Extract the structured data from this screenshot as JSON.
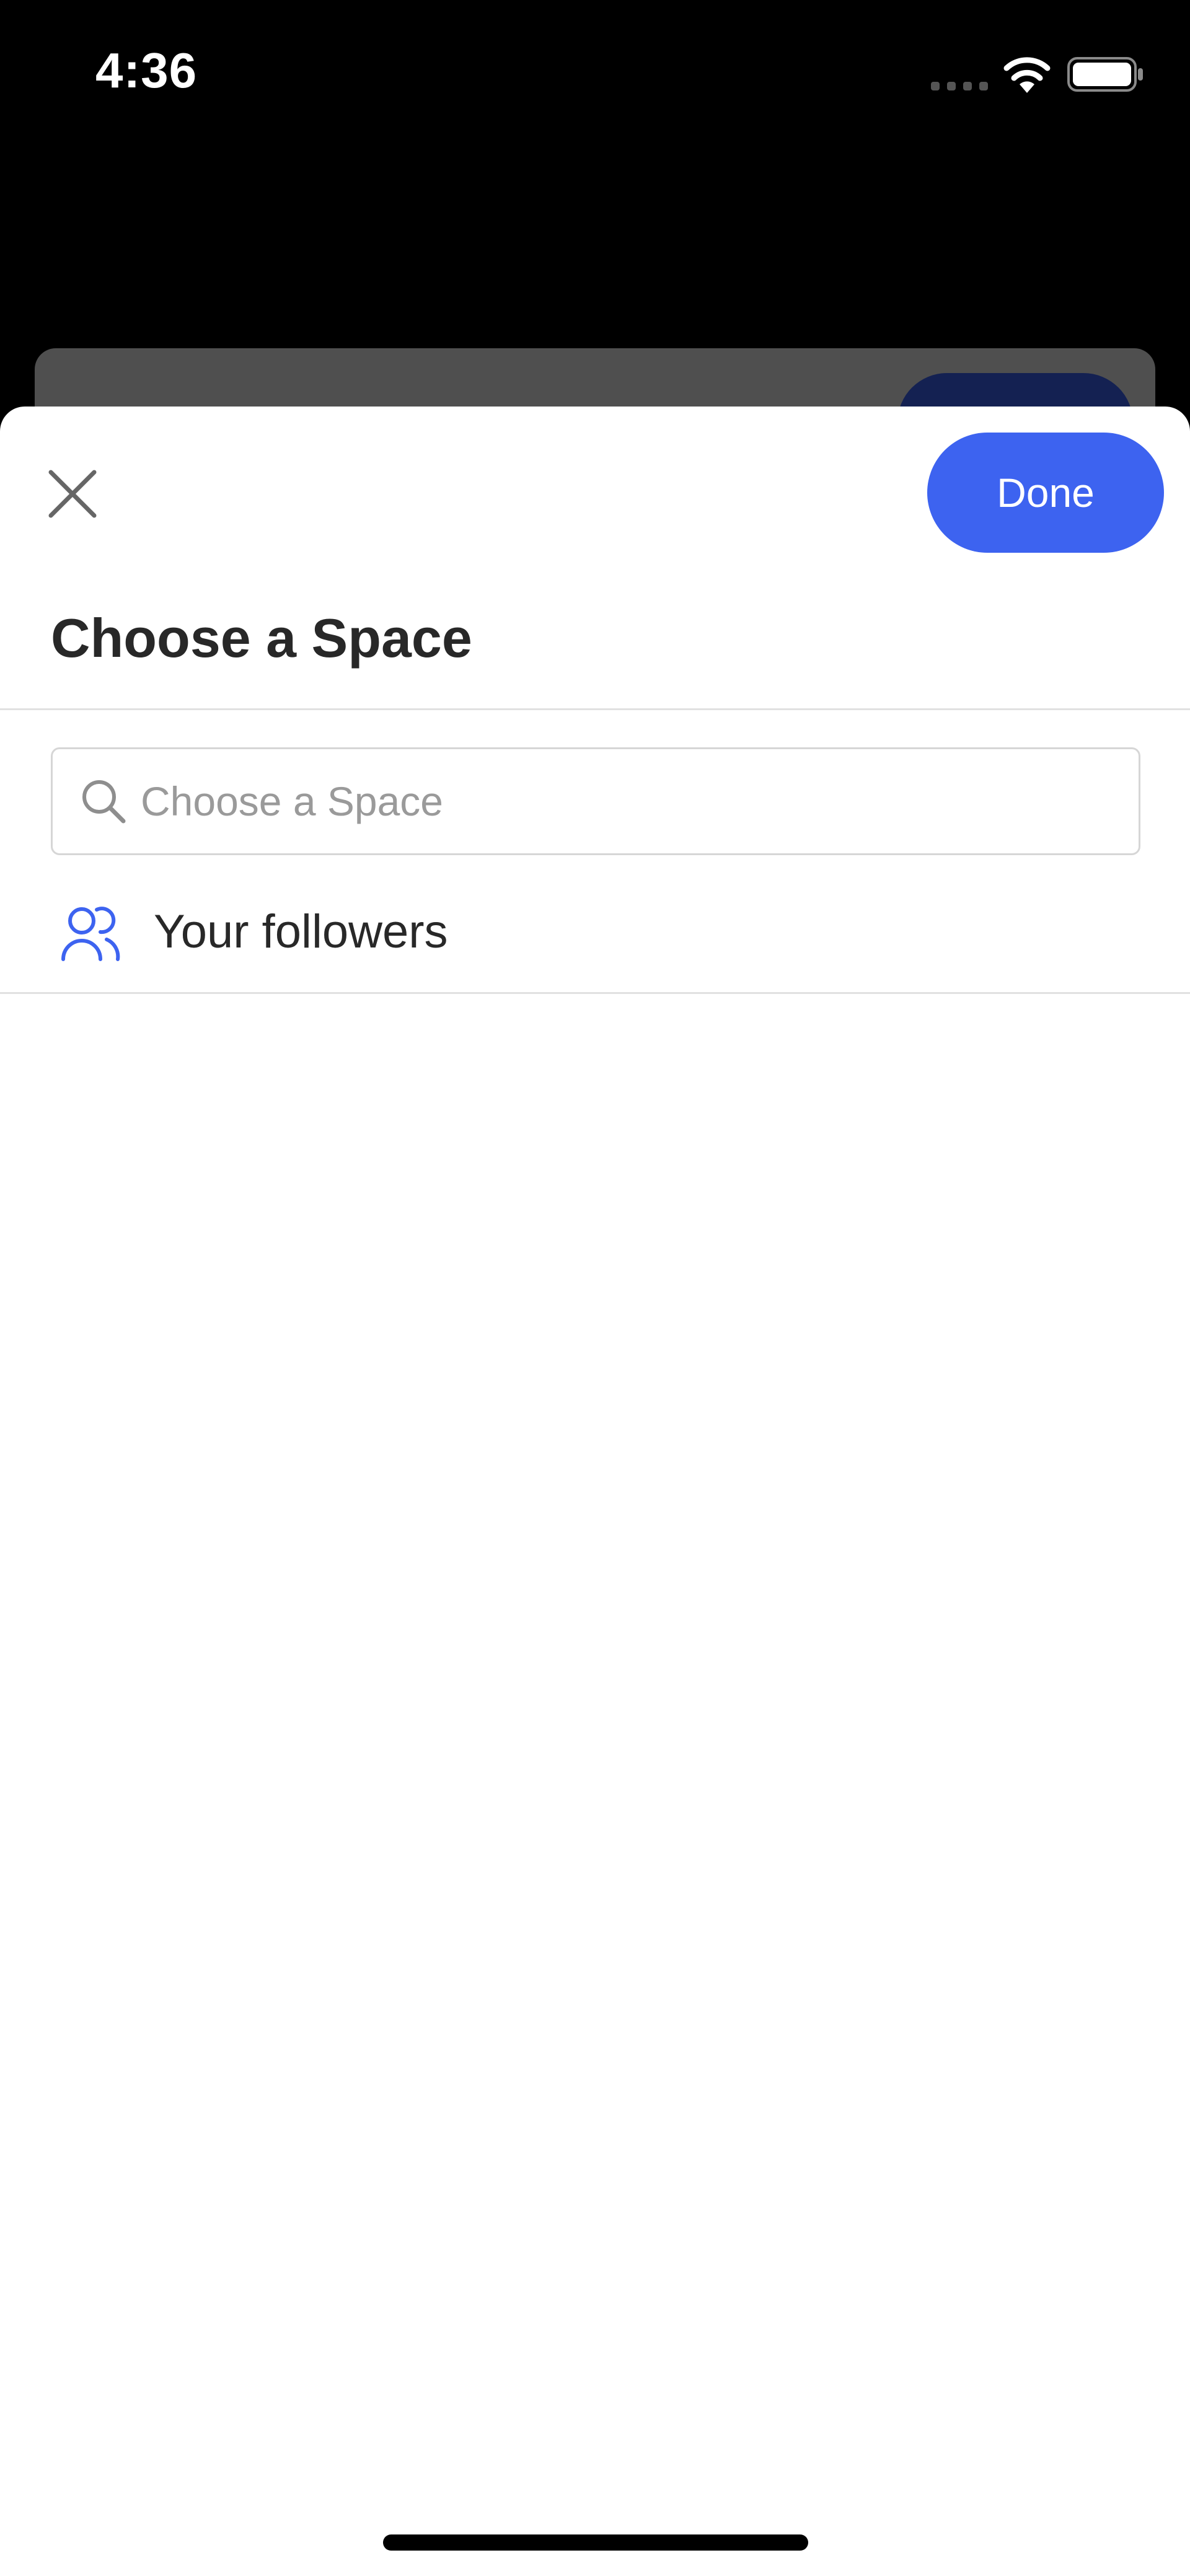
{
  "status_bar": {
    "time": "4:36",
    "signal_icon": "signal-dots-icon",
    "wifi_icon": "wifi-icon",
    "battery_icon": "battery-full-icon"
  },
  "sheet": {
    "close_icon": "close-icon",
    "done_label": "Done",
    "title": "Choose a Space",
    "search": {
      "placeholder": "Choose a Space",
      "value": "",
      "icon": "search-icon"
    },
    "items": [
      {
        "label": "Your followers",
        "icon": "followers-icon"
      }
    ]
  },
  "colors": {
    "accent": "#3d63f0",
    "title_text": "#282828",
    "placeholder_text": "#9a9a9a",
    "divider": "#e1e1e1"
  }
}
